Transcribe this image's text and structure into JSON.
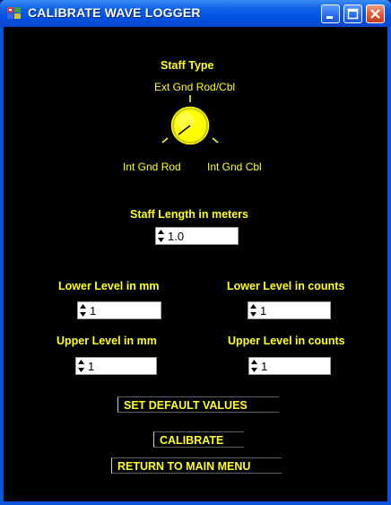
{
  "window": {
    "title": "CALIBRATE WAVE LOGGER"
  },
  "staff_type": {
    "heading": "Staff Type",
    "option_top": "Ext Gnd Rod/Cbl",
    "option_left": "Int Gnd Rod",
    "option_right": "Int Gnd Cbl"
  },
  "staff_length": {
    "label": "Staff Length in meters",
    "value": "1.0"
  },
  "lower_mm": {
    "label": "Lower Level in mm",
    "value": "1"
  },
  "lower_counts": {
    "label": "Lower Level in counts",
    "value": "1"
  },
  "upper_mm": {
    "label": "Upper Level in mm",
    "value": "1"
  },
  "upper_counts": {
    "label": "Upper Level in counts",
    "value": "1"
  },
  "buttons": {
    "set_default": "SET DEFAULT VALUES",
    "calibrate": "CALIBRATE",
    "return_main": "RETURN TO MAIN MENU"
  },
  "colors": {
    "label": "#ffff22",
    "background": "#000000",
    "knob": "#ffff00"
  },
  "icons": [
    "app-icon",
    "minimize-icon",
    "maximize-icon",
    "close-icon",
    "spinner-arrows-icon"
  ]
}
